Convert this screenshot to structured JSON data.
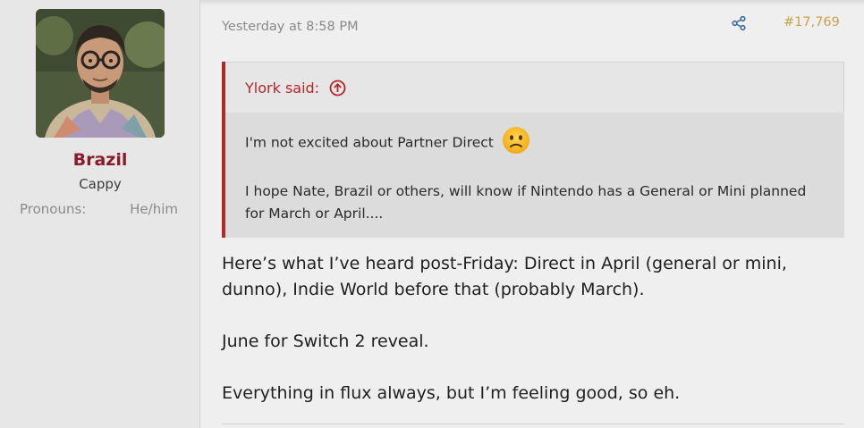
{
  "user": {
    "name": "Brazil",
    "title": "Cappy",
    "pronouns_label": "Pronouns:",
    "pronouns_value": "He/him"
  },
  "post": {
    "timestamp": "Yesterday at 8:58 PM",
    "number": "#17,769",
    "quote": {
      "author": "Ylork said:",
      "line1": "I'm not excited about Partner Direct",
      "emoji": "slightly-frowning-face",
      "line2": "I hope Nate, Brazil or others, will know if Nintendo has a General or Mini planned for March or April...."
    },
    "body": [
      "Here’s what I’ve heard post-Friday: Direct in April (general or mini, dunno), Indie World before that (probably March).",
      "June for Switch 2 reveal.",
      "Everything in flux always, but I’m feeling good, so eh."
    ]
  },
  "colors": {
    "username": "#8b1a2b",
    "quote_accent": "#b3262b",
    "post_number": "#c9a24a",
    "share_icon": "#3b6e9e"
  }
}
